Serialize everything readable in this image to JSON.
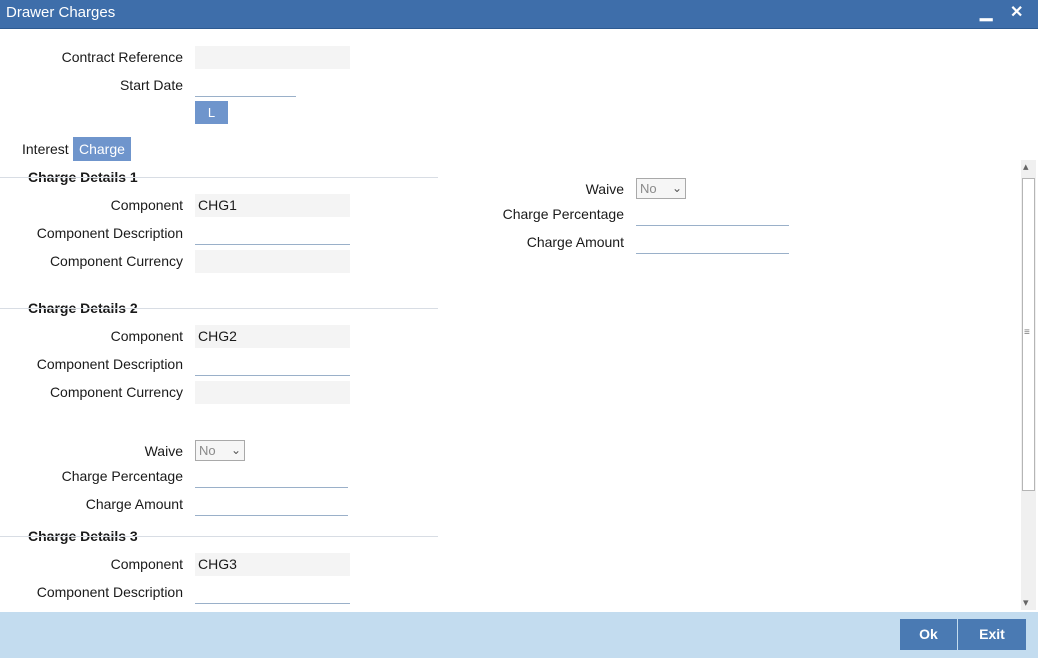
{
  "window": {
    "title": "Drawer Charges",
    "minimize_glyph": "▁",
    "close_glyph": "✕"
  },
  "header": {
    "contract_reference_label": "Contract Reference",
    "contract_reference_value": "",
    "start_date_label": "Start Date",
    "start_date_value": "",
    "l_button_label": "L"
  },
  "tabs": [
    {
      "label": "Interest",
      "active": false
    },
    {
      "label": "Charge",
      "active": true
    }
  ],
  "charge_details_1": {
    "title": "Charge Details 1",
    "component_label": "Component",
    "component_value": "CHG1",
    "description_label": "Component Description",
    "description_value": "",
    "currency_label": "Component Currency",
    "currency_value": "",
    "waive_label": "Waive",
    "waive_value": "No",
    "percentage_label": "Charge Percentage",
    "percentage_value": "",
    "amount_label": "Charge Amount",
    "amount_value": ""
  },
  "charge_details_2": {
    "title": "Charge Details 2",
    "component_label": "Component",
    "component_value": "CHG2",
    "description_label": "Component Description",
    "description_value": "",
    "currency_label": "Component Currency",
    "currency_value": "",
    "waive_label": "Waive",
    "waive_value": "No",
    "percentage_label": "Charge Percentage",
    "percentage_value": "",
    "amount_label": "Charge Amount",
    "amount_value": ""
  },
  "charge_details_3": {
    "title": "Charge Details 3",
    "component_label": "Component",
    "component_value": "CHG3",
    "description_label": "Component Description",
    "description_value": ""
  },
  "scrollbar": {
    "up_glyph": "▴",
    "down_glyph": "▾",
    "grip_glyph": "≡"
  },
  "footer": {
    "ok_label": "Ok",
    "exit_label": "Exit"
  },
  "colors": {
    "titlebar": "#3e6eaa",
    "accent": "#6f95cc",
    "footer": "#c3dcef",
    "footer_button": "#4a7ab3"
  }
}
